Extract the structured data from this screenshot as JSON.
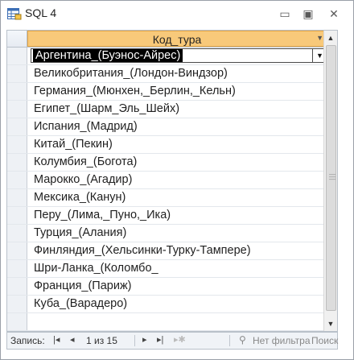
{
  "window": {
    "title": "SQL 4",
    "minimize_icon": "minimize-icon",
    "restore_icon": "restore-icon",
    "close_icon": "close-icon"
  },
  "grid": {
    "column_header": "Код_тура",
    "current_value": "Аргентина_(Буэнос-Айрес)",
    "rows": [
      "Великобритания_(Лондон-Виндзор)",
      "Германия_(Мюнхен,_Берлин,_Кельн)",
      "Египет_(Шарм_Эль_Шейх)",
      "Испания_(Мадрид)",
      "Китай_(Пекин)",
      "Колумбия_(Богота)",
      "Марокко_(Агадир)",
      "Мексика_(Канун)",
      "Перу_(Лима,_Пуно,_Ика)",
      "Турция_(Алания)",
      "Финляндия_(Хельсинки-Турку-Тампере)",
      "Шри-Ланка_(Коломбо_",
      "Франция_(Париж)",
      "Куба_(Варадеро)"
    ]
  },
  "navigation": {
    "label": "Запись:",
    "current": "1 из 15",
    "filter": "Нет фильтра",
    "search": "Поиск"
  }
}
